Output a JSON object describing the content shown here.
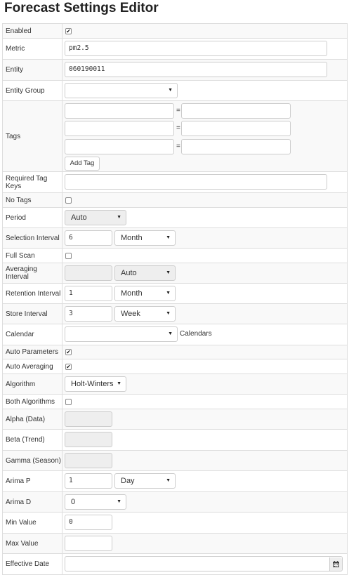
{
  "title": "Forecast Settings Editor",
  "fields": {
    "enabled": {
      "label": "Enabled",
      "checked": true
    },
    "metric": {
      "label": "Metric",
      "value": "pm2.5"
    },
    "entity": {
      "label": "Entity",
      "value": "060190011"
    },
    "entity_group": {
      "label": "Entity Group",
      "value": ""
    },
    "tags": {
      "label": "Tags",
      "add_tag": "Add Tag",
      "eq": "="
    },
    "required_tag_keys": {
      "label": "Required Tag Keys",
      "value": ""
    },
    "no_tags": {
      "label": "No Tags",
      "checked": false
    },
    "period": {
      "label": "Period",
      "value": "Auto"
    },
    "selection_interval": {
      "label": "Selection Interval",
      "value": "6",
      "unit": "Month"
    },
    "full_scan": {
      "label": "Full Scan",
      "checked": false
    },
    "averaging_interval": {
      "label": "Averaging Interval",
      "value": "",
      "unit": "Auto"
    },
    "retention_interval": {
      "label": "Retention Interval",
      "value": "1",
      "unit": "Month"
    },
    "store_interval": {
      "label": "Store Interval",
      "value": "3",
      "unit": "Week"
    },
    "calendar": {
      "label": "Calendar",
      "value": "",
      "link": "Calendars"
    },
    "auto_parameters": {
      "label": "Auto Parameters",
      "checked": true
    },
    "auto_averaging": {
      "label": "Auto Averaging",
      "checked": true
    },
    "algorithm": {
      "label": "Algorithm",
      "value": "Holt-Winters"
    },
    "both_algorithms": {
      "label": "Both Algorithms",
      "checked": false
    },
    "alpha": {
      "label": "Alpha (Data)",
      "value": ""
    },
    "beta": {
      "label": "Beta (Trend)",
      "value": ""
    },
    "gamma": {
      "label": "Gamma (Season)",
      "value": ""
    },
    "arima_p": {
      "label": "Arima P",
      "value": "1",
      "unit": "Day"
    },
    "arima_d": {
      "label": "Arima D",
      "value": "0"
    },
    "min_value": {
      "label": "Min Value",
      "value": "0"
    },
    "max_value": {
      "label": "Max Value",
      "value": ""
    },
    "effective_date": {
      "label": "Effective Date",
      "value": "",
      "icon": "calendar-icon"
    }
  }
}
